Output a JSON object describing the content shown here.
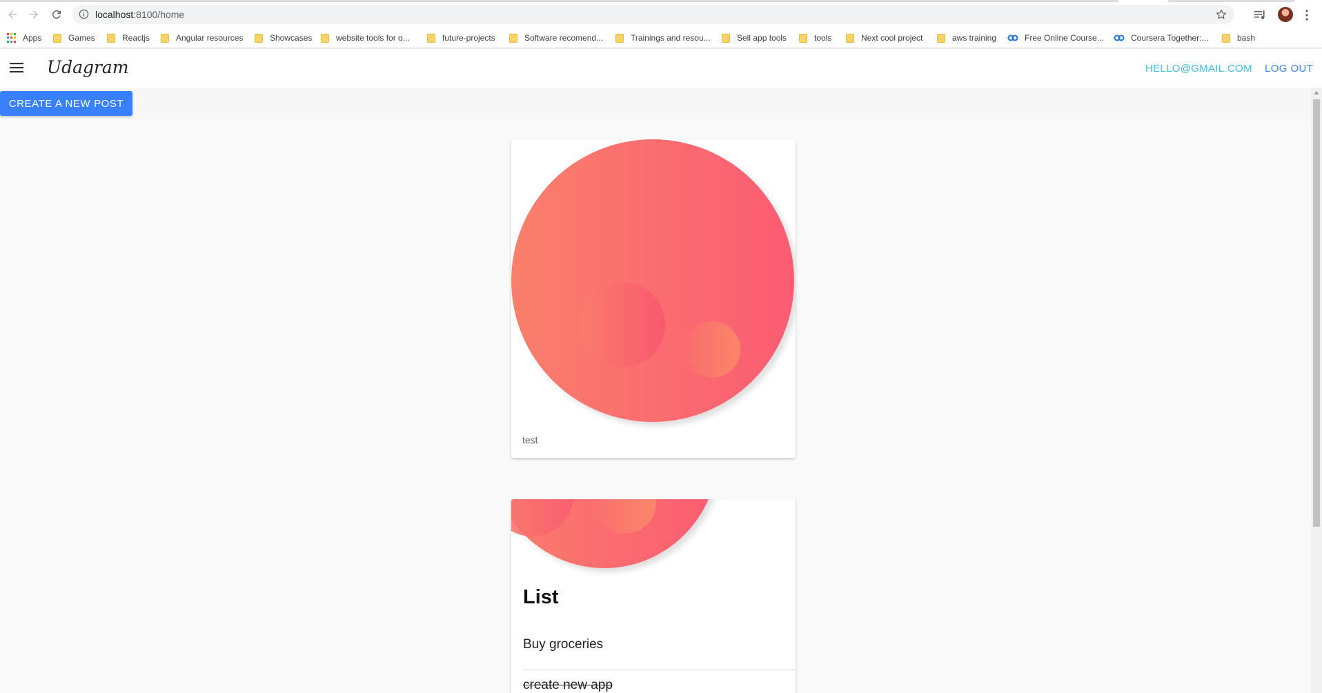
{
  "browser": {
    "url_host": "localhost",
    "url_path": ":8100/home",
    "bookmarks": [
      {
        "label": "Apps",
        "icon": "apps-grid-icon"
      },
      {
        "label": "Games",
        "icon": "folder-icon"
      },
      {
        "label": "Reactjs",
        "icon": "folder-icon"
      },
      {
        "label": "Angular resources",
        "icon": "folder-icon"
      },
      {
        "label": "Showcases",
        "icon": "folder-icon"
      },
      {
        "label": "website tools for o...",
        "icon": "folder-icon"
      },
      {
        "label": "future-projects",
        "icon": "folder-icon"
      },
      {
        "label": "Software recomend...",
        "icon": "folder-icon"
      },
      {
        "label": "Trainings and resou...",
        "icon": "folder-icon"
      },
      {
        "label": "Sell app tools",
        "icon": "folder-icon"
      },
      {
        "label": "tools",
        "icon": "folder-icon"
      },
      {
        "label": "Next cool project",
        "icon": "folder-icon"
      },
      {
        "label": "aws training",
        "icon": "folder-icon"
      },
      {
        "label": "Free Online Course...",
        "icon": "coursera-link-icon"
      },
      {
        "label": "Coursera Together:...",
        "icon": "coursera-link-icon"
      },
      {
        "label": "bash",
        "icon": "folder-icon"
      }
    ]
  },
  "toolbar": {
    "brand": "Udagram",
    "user_email": "hello@gmail.com",
    "logout_label": "LOG OUT"
  },
  "actions": {
    "create_post_label": "CREATE A NEW POST"
  },
  "feed": {
    "posts": [
      {
        "caption": "test"
      }
    ],
    "list_card": {
      "title": "List",
      "items": [
        {
          "label": "Buy groceries"
        },
        {
          "label": "create new app"
        }
      ]
    }
  },
  "colors": {
    "primary": "#3880ff",
    "secondary": "#3bbfe3",
    "blob_start": "#fa7f6c",
    "blob_end": "#fb5c72"
  }
}
